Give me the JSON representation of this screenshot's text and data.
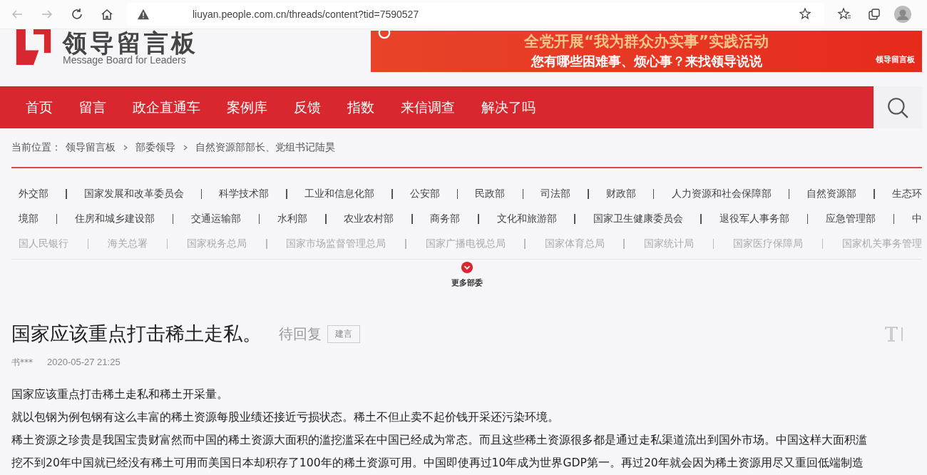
{
  "browser": {
    "url": "liuyan.people.com.cn/threads/content?tid=7590527"
  },
  "header": {
    "logo_title": "领导留言板",
    "logo_subtitle": "Message Board for Leaders",
    "banner": {
      "headline": "全党开展“我为群众办实事”实践活动",
      "subline": "您有哪些困难事、烦心事？来找领导说说",
      "badge": "领导留言板"
    }
  },
  "nav": [
    {
      "label": "首页",
      "selected": false
    },
    {
      "label": "留言",
      "selected": false
    },
    {
      "label": "政企直通车",
      "selected": false
    },
    {
      "label": "案例库",
      "selected": false
    },
    {
      "label": "反馈",
      "selected": false
    },
    {
      "label": "指数",
      "selected": false
    },
    {
      "label": "来信调查",
      "selected": false
    },
    {
      "label": "解决了吗",
      "selected": false
    }
  ],
  "breadcrumb": {
    "label": "当前位置：",
    "items": [
      "领导留言板",
      "部委领导",
      "自然资源部部长、党组书记陆昊"
    ]
  },
  "department_rows": [
    [
      "外交部",
      "国家发展和改革委员会",
      "科学技术部",
      "工业和信息化部",
      "公安部",
      "民政部",
      "司法部",
      "财政部",
      "人力资源和社会保障部",
      "自然资源部",
      "生态环"
    ],
    [
      "境部",
      "住房和城乡建设部",
      "交通运输部",
      "水利部",
      "农业农村部",
      "商务部",
      "文化和旅游部",
      "国家卫生健康委员会",
      "退役军人事务部",
      "应急管理部",
      "中"
    ],
    [
      "国人民银行",
      "海关总署",
      "国家税务总局",
      "国家市场监督管理总局",
      "国家广播电视总局",
      "国家体育总局",
      "国家统计局",
      "国家医疗保障局",
      "国家机关事务管理"
    ]
  ],
  "more_button": "更多部委",
  "post": {
    "title": "国家应该重点打击稀土走私。",
    "status": "待回复",
    "tag": "建言",
    "author": "书***",
    "time": "2020-05-27 21:25",
    "paragraphs": [
      "国家应该重点打击稀土走私和稀土开采量。",
      "就以包钢为例包钢有这么丰富的稀土资源每股业绩还接近亏损状态。稀土不但止卖不起价钱开采还污染环境。",
      "稀土资源之珍贵是我国宝贵财富然而中国的稀土资源大面积的滥挖滥采在中国已经成为常态。而且这些稀土资源很多都是通过走私渠道流出到国外市场。中国这样大面积滥",
      "挖不到20年中国就已经没有稀土可用而美国日本却积存了100年的稀土资源可用。中国即使再过10年成为世界GDP第一。再过20年就会因为稀土资源用尽又重回低端制造"
    ]
  }
}
